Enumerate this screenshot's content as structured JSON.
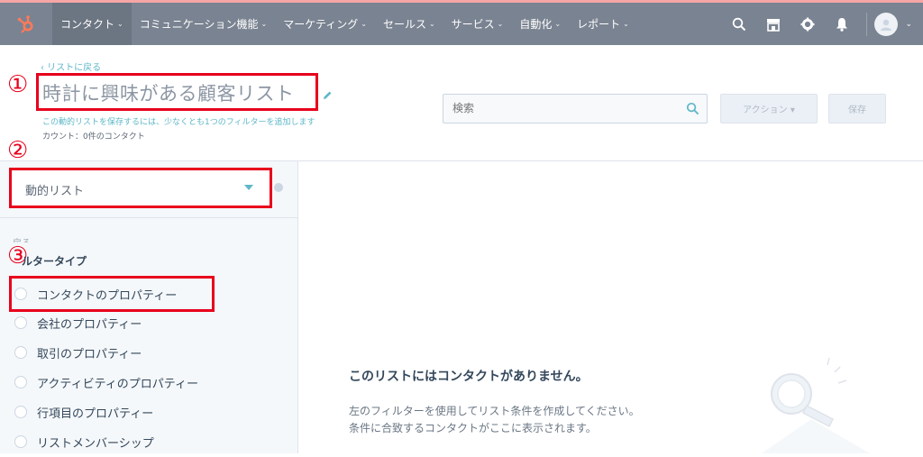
{
  "nav": {
    "items": [
      {
        "label": "コンタクト",
        "active": true
      },
      {
        "label": "コミュニケーション機能",
        "active": false
      },
      {
        "label": "マーケティング",
        "active": false
      },
      {
        "label": "セールス",
        "active": false
      },
      {
        "label": "サービス",
        "active": false
      },
      {
        "label": "自動化",
        "active": false
      },
      {
        "label": "レポート",
        "active": false
      }
    ],
    "icons": [
      "hubspot-logo-icon",
      "search-icon",
      "marketplace-icon",
      "gear-icon",
      "bell-icon",
      "avatar-icon"
    ]
  },
  "header": {
    "back_link": "‹ リストに戻る",
    "title": "時計に興味がある顧客リスト",
    "hint": "この動的リストを保存するには、少なくとも1つのフィルターを追加します",
    "count": "カウント：0件のコンタクト"
  },
  "search": {
    "placeholder": "検索"
  },
  "buttons": {
    "actions": "アクション ▾",
    "save": "保存"
  },
  "annotations": {
    "badge1": "①",
    "badge2": "②",
    "badge3": "③"
  },
  "sidebar": {
    "list_type": "動的リスト",
    "back": "戻る",
    "filter_heading": "フィルタータイプ",
    "filter_heading_visible": "ルタータイプ",
    "filters": [
      "コンタクトのプロパティー",
      "会社のプロパティー",
      "取引のプロパティー",
      "アクティビティのプロパティー",
      "行項目のプロパティー",
      "リストメンバーシップ"
    ]
  },
  "empty_state": {
    "title": "このリストにはコンタクトがありません。",
    "line1": "左のフィルターを使用してリスト条件を作成してください。",
    "line2": "条件に合致するコンタクトがここに表示されます。"
  },
  "colors": {
    "nav_bg": "#7a8391",
    "accent": "#5fb7c8",
    "annotation_red": "#e8001c"
  }
}
